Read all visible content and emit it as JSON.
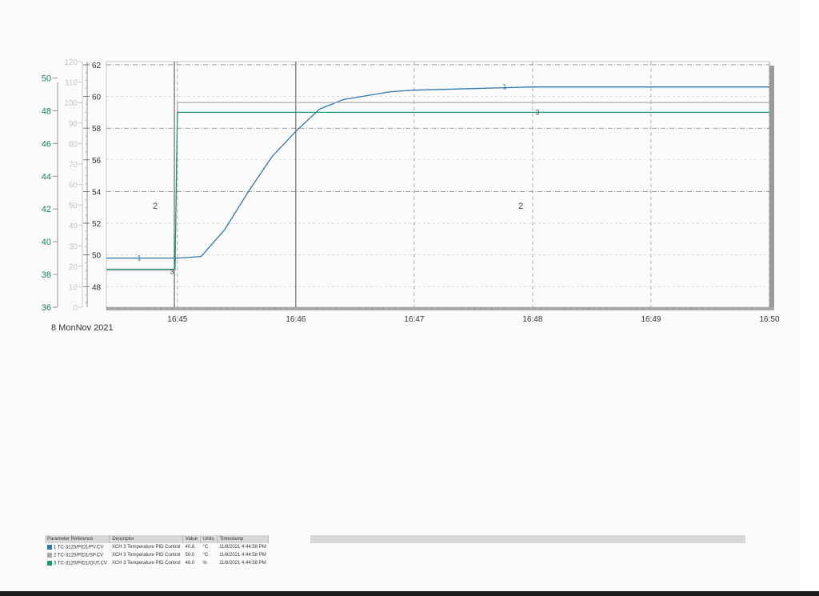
{
  "date_label": "8 MonNov 2021",
  "colors": {
    "pv": "#2f78b0",
    "sp": "#a8a8a8",
    "out": "#1f9a6c",
    "grid": "#555555",
    "axis_green": "#1f7f5a"
  },
  "chart_data": {
    "type": "line",
    "title": "",
    "x": {
      "ticks": [
        "16:45",
        "16:46",
        "16:47",
        "16:48",
        "16:49",
        "16:50"
      ],
      "range": [
        "16:44.4",
        "16:50"
      ]
    },
    "y_axes": [
      {
        "name": "axis-left-green",
        "range": [
          36,
          51
        ],
        "ticks": [
          36,
          38,
          40,
          42,
          44,
          46,
          48,
          50
        ]
      },
      {
        "name": "axis-grey",
        "range": [
          0,
          120
        ],
        "ticks": [
          0,
          10,
          20,
          30,
          40,
          50,
          60,
          70,
          80,
          90,
          100,
          110,
          120
        ]
      },
      {
        "name": "axis-inner",
        "range": [
          46.7,
          62.2
        ],
        "ticks": [
          48,
          50,
          52,
          54,
          56,
          58,
          60,
          62
        ]
      }
    ],
    "series": [
      {
        "label_mark": "1",
        "axis": "axis-inner",
        "x": [
          "16:44.4",
          "16:45",
          "16:45.2",
          "16:45.4",
          "16:45.6",
          "16:45.8",
          "16:46",
          "16:46.2",
          "16:46.4",
          "16:46.8",
          "16:47",
          "16:47.5",
          "16:48",
          "16:48.5",
          "16:49",
          "16:49.5",
          "16:50"
        ],
        "values": [
          49.8,
          49.8,
          49.9,
          51.6,
          54.0,
          56.2,
          57.8,
          59.2,
          59.8,
          60.3,
          60.4,
          60.5,
          60.6,
          60.6,
          60.6,
          60.6,
          60.6
        ]
      },
      {
        "label_mark": "2",
        "axis": "axis-grey",
        "x": [
          "16:44.4",
          "16:44.98",
          "16:45.0",
          "16:50"
        ],
        "values": [
          18,
          18,
          100,
          100
        ]
      },
      {
        "label_mark": "3",
        "axis": "axis-inner",
        "x": [
          "16:44.4",
          "16:44.98",
          "16:45.0",
          "16:50"
        ],
        "values": [
          49.1,
          49.1,
          59.0,
          59.0
        ]
      }
    ],
    "region_labels": [
      "2",
      "2"
    ],
    "grid": true
  },
  "legend": {
    "headers": [
      "Parameter Reference",
      "Descriptor",
      "Value",
      "Units",
      "Timestamp"
    ],
    "rows": [
      {
        "ref": "1 TC-3120/PID1/PV.CV",
        "desc": "XCH 3 Temperature PID Control",
        "value": "40.6",
        "units": "°C",
        "ts": "11/8/2021 4:44:58 PM",
        "color": "#2f78b0"
      },
      {
        "ref": "2 TC-3120/PID1/SP.CV",
        "desc": "XCH 3 Temperature PID Control",
        "value": "50.0",
        "units": "°C",
        "ts": "11/8/2021 4:44:58 PM",
        "color": "#a8a8a8"
      },
      {
        "ref": "3 TC-3120/PID1/OUT.CV",
        "desc": "XCH 3 Temperature PID Control",
        "value": "48.0",
        "units": "%",
        "ts": "11/8/2021 4:44:58 PM",
        "color": "#1f9a6c"
      }
    ]
  }
}
